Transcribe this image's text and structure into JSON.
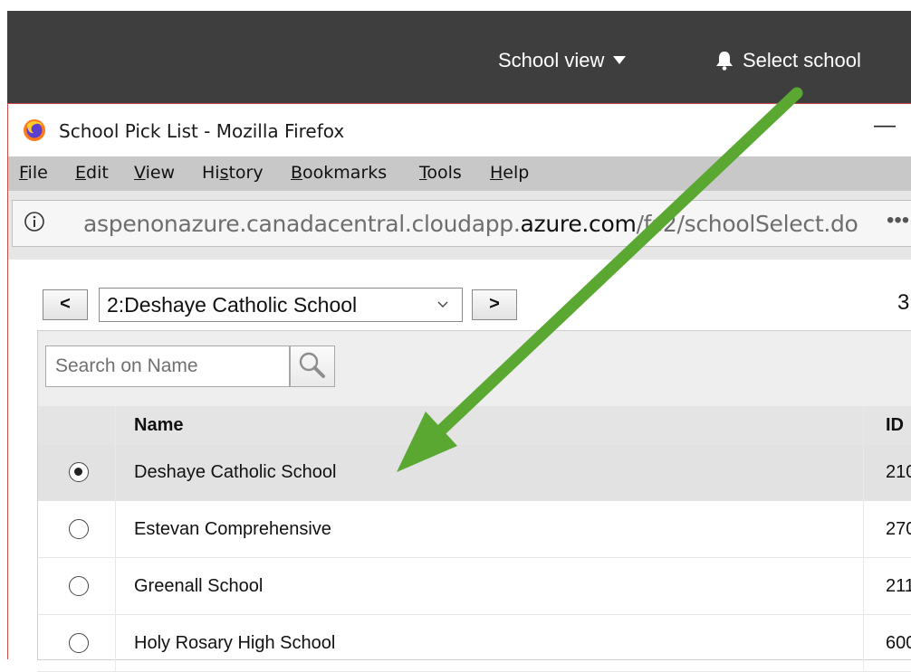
{
  "app_header": {
    "school_view_label": "School view",
    "select_school_label": "Select school"
  },
  "window": {
    "title": "School Pick List - Mozilla Firefox",
    "minimize_glyph": "—"
  },
  "menu": [
    {
      "pre": "",
      "key": "F",
      "post": "ile"
    },
    {
      "pre": "",
      "key": "E",
      "post": "dit"
    },
    {
      "pre": "",
      "key": "V",
      "post": "iew"
    },
    {
      "pre": "Hi",
      "key": "s",
      "post": "tory"
    },
    {
      "pre": "",
      "key": "B",
      "post": "ookmarks"
    },
    {
      "pre": "",
      "key": "T",
      "post": "ools"
    },
    {
      "pre": "",
      "key": "H",
      "post": "elp"
    }
  ],
  "urlbar": {
    "url_prefix": "aspenonazure.canadacentral.cloudapp.",
    "url_domain": "azure.com",
    "url_path": "/fs2/schoolSelect.do",
    "more_glyph": "•••"
  },
  "school_nav": {
    "prev_label": "<",
    "next_label": ">",
    "selected_school": "2:Deshaye Catholic School",
    "right_text": "3"
  },
  "search": {
    "placeholder": "Search on Name"
  },
  "table": {
    "columns": [
      "Name",
      "ID"
    ],
    "rows": [
      {
        "name": "Deshaye Catholic School",
        "id": "210",
        "selected": true
      },
      {
        "name": "Estevan Comprehensive",
        "id": "270",
        "selected": false
      },
      {
        "name": "Greenall School",
        "id": "211",
        "selected": false
      },
      {
        "name": "Holy Rosary High School",
        "id": "600",
        "selected": false
      }
    ]
  },
  "colors": {
    "header_bg": "#3e3e3e",
    "arrow": "#5aa832",
    "menubar_bg": "#c8c8c8"
  },
  "icons": [
    "bell-icon",
    "caret-down-icon",
    "firefox-logo-icon",
    "info-icon",
    "magnifier-icon",
    "chevron-down-icon"
  ]
}
